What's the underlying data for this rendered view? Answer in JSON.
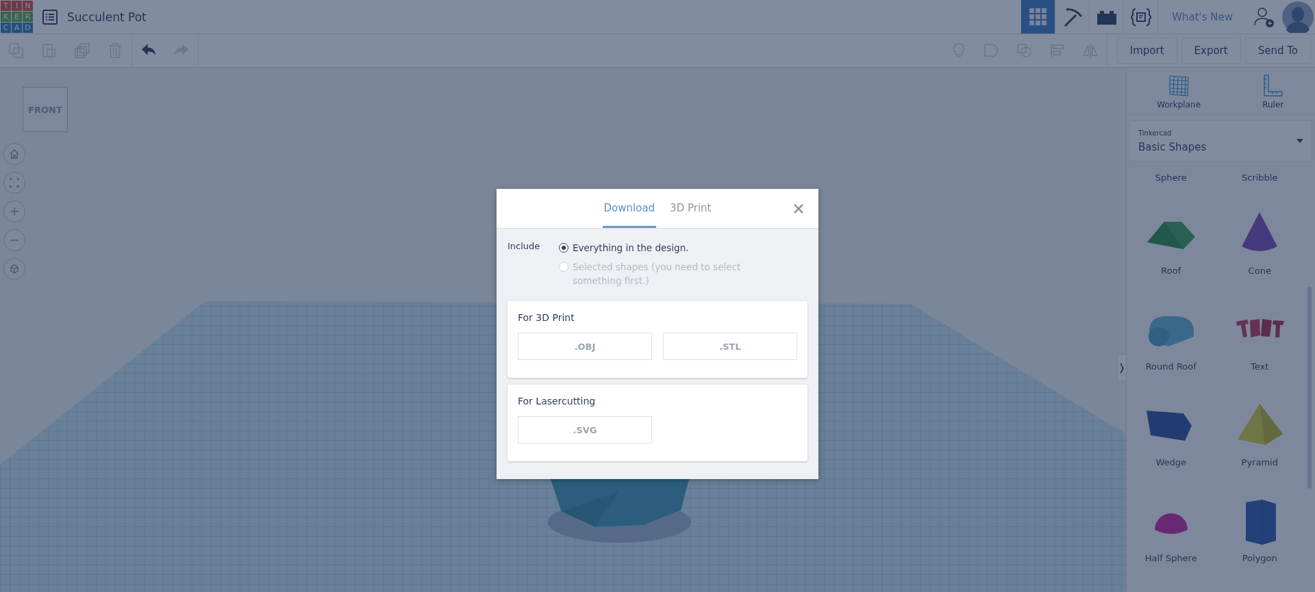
{
  "app": {
    "logo_letters": [
      "T",
      "I",
      "N",
      "K",
      "E",
      "R",
      "C",
      "A",
      "D"
    ],
    "design_title": "Succulent Pot"
  },
  "header": {
    "views": [
      {
        "kind": "grid",
        "selected": true
      },
      {
        "kind": "pickaxe",
        "selected": false
      },
      {
        "kind": "bricks",
        "selected": false
      },
      {
        "kind": "code",
        "selected": false
      }
    ],
    "whats_new": "What's New"
  },
  "toolbar": {
    "edit_tools": [
      {
        "kind": "copy",
        "disabled": true
      },
      {
        "kind": "paste",
        "disabled": true
      },
      {
        "kind": "duplicate",
        "disabled": true
      },
      {
        "kind": "delete",
        "disabled": true
      },
      {
        "kind": "undo",
        "disabled": false
      },
      {
        "kind": "redo",
        "disabled": true
      }
    ],
    "actions": [
      "Import",
      "Export",
      "Send To"
    ]
  },
  "view_cube": {
    "face": "FRONT"
  },
  "panel": {
    "tools": [
      {
        "kind": "workplane",
        "label": "Workplane"
      },
      {
        "kind": "ruler",
        "label": "Ruler"
      }
    ],
    "library": {
      "caption": "Tinkercad",
      "value": "Basic Shapes"
    },
    "shapes_partial": [
      "Sphere",
      "Scribble"
    ],
    "shapes": [
      {
        "kind": "roof",
        "label": "Roof"
      },
      {
        "kind": "cone",
        "label": "Cone"
      },
      {
        "kind": "roundroof",
        "label": "Round Roof"
      },
      {
        "kind": "text",
        "label": "Text"
      },
      {
        "kind": "wedge",
        "label": "Wedge"
      },
      {
        "kind": "pyramid",
        "label": "Pyramid"
      },
      {
        "kind": "halfsphere",
        "label": "Half Sphere"
      },
      {
        "kind": "polygon",
        "label": "Polygon"
      }
    ],
    "collapse": "❭"
  },
  "dialog": {
    "tabs": [
      {
        "label": "Download",
        "selected": true
      },
      {
        "label": "3D Print",
        "selected": false
      }
    ],
    "include_label": "Include",
    "options": [
      {
        "label": "Everything in the design.",
        "selected": true,
        "disabled": false
      },
      {
        "label": "Selected shapes (you need to select something first.)",
        "selected": false,
        "disabled": true
      }
    ],
    "sections": [
      {
        "title": "For 3D Print",
        "formats": [
          ".OBJ",
          ".STL"
        ]
      },
      {
        "title": "For Lasercutting",
        "formats": [
          ".SVG"
        ]
      }
    ]
  }
}
